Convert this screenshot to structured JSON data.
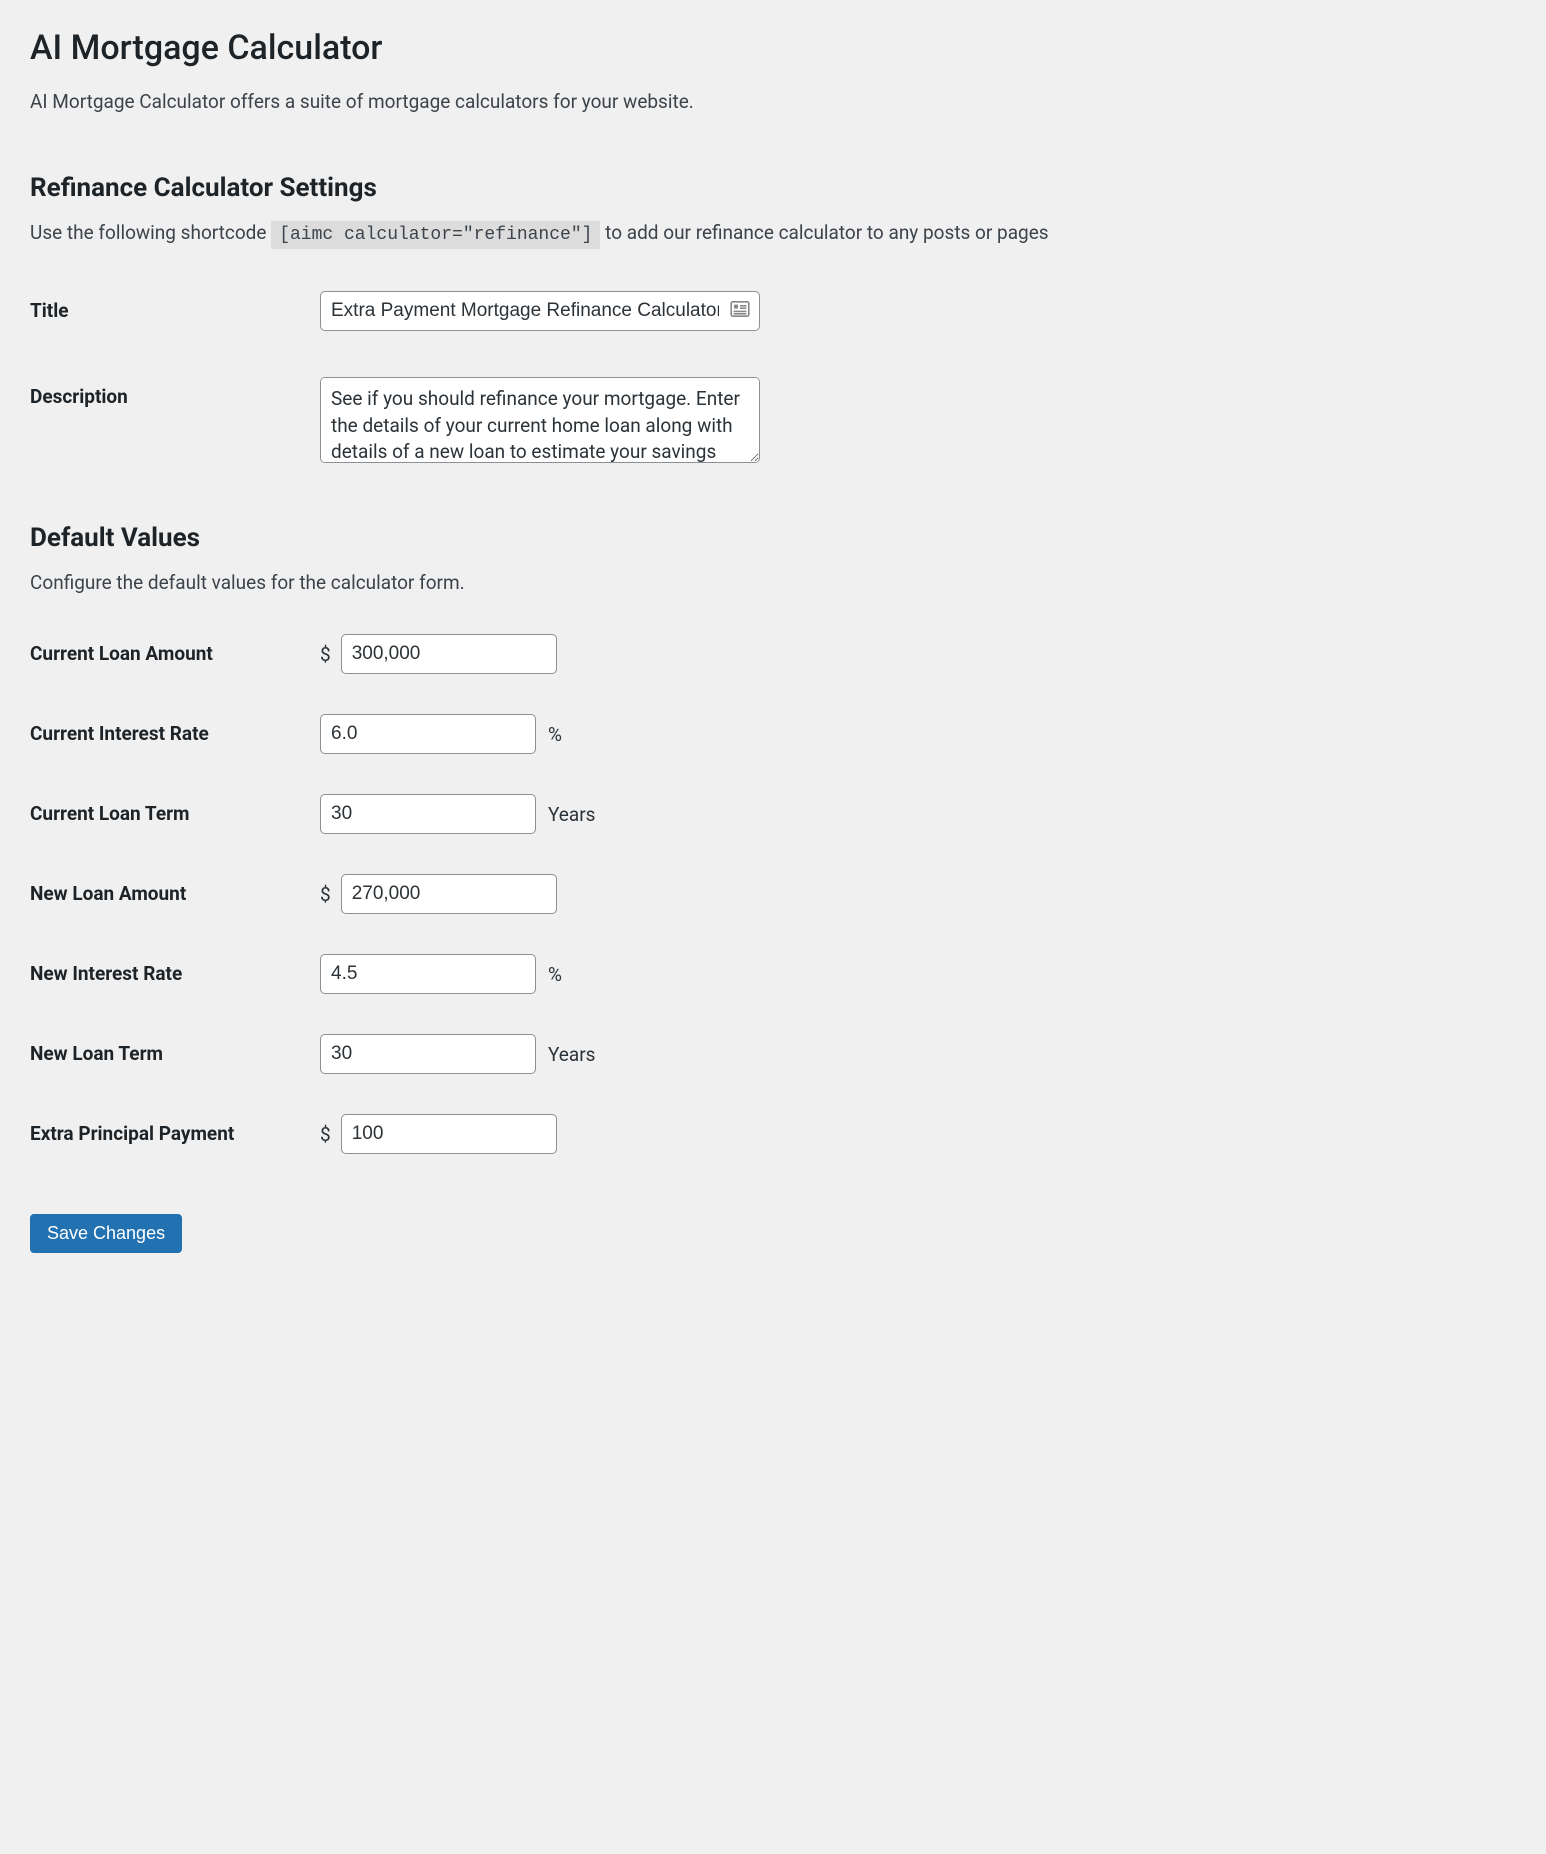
{
  "page": {
    "title": "AI Mortgage Calculator",
    "intro": "AI Mortgage Calculator offers a suite of mortgage calculators for your website."
  },
  "refinance": {
    "heading": "Refinance Calculator Settings",
    "desc_pre": "Use the following shortcode ",
    "shortcode": "[aimc calculator=\"refinance\"]",
    "desc_post": " to add our refinance calculator to any posts or pages",
    "fields": {
      "title_label": "Title",
      "title_value": "Extra Payment Mortgage Refinance Calculator",
      "description_label": "Description",
      "description_value": "See if you should refinance your mortgage. Enter the details of your current home loan along with details of a new loan to estimate your savings and see if refinancing can help you achieve your financial goals."
    }
  },
  "defaults": {
    "heading": "Default Values",
    "desc": "Configure the default values for the calculator form.",
    "prefix_dollar": "$",
    "suffix_percent": "%",
    "suffix_years": "Years",
    "fields": {
      "current_loan_amount_label": "Current Loan Amount",
      "current_loan_amount_value": "300,000",
      "current_interest_rate_label": "Current Interest Rate",
      "current_interest_rate_value": "6.0",
      "current_loan_term_label": "Current Loan Term",
      "current_loan_term_value": "30",
      "new_loan_amount_label": "New Loan Amount",
      "new_loan_amount_value": "270,000",
      "new_interest_rate_label": "New Interest Rate",
      "new_interest_rate_value": "4.5",
      "new_loan_term_label": "New Loan Term",
      "new_loan_term_value": "30",
      "extra_principal_payment_label": "Extra Principal Payment",
      "extra_principal_payment_value": "100"
    }
  },
  "actions": {
    "save_label": "Save Changes"
  }
}
